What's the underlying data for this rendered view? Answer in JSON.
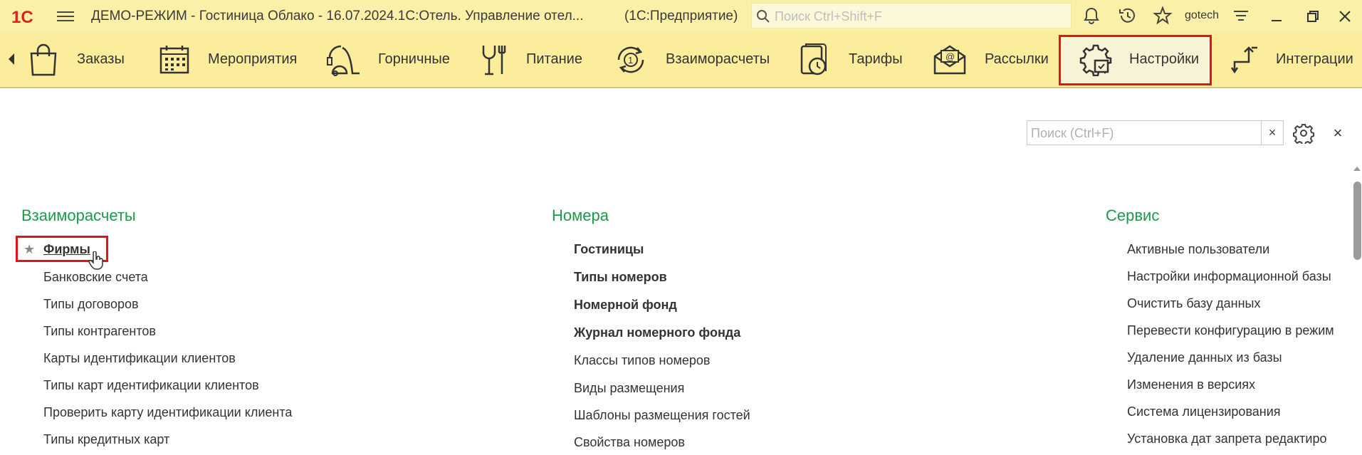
{
  "window": {
    "title": "ДЕМО-РЕЖИМ - Гостиница Облако - 16.07.2024.1С:Отель. Управление отел...",
    "suffix": "(1С:Предприятие)",
    "search_placeholder": "Поиск Ctrl+Shift+F",
    "user": "gotech",
    "logo_text": "1С"
  },
  "sections": [
    {
      "label": "Заказы",
      "icon": "shopping-bag-icon"
    },
    {
      "label": "Мероприятия",
      "icon": "calendar-icon"
    },
    {
      "label": "Горничные",
      "icon": "vacuum-cleaner-icon"
    },
    {
      "label": "Питание",
      "icon": "glass-fork-icon"
    },
    {
      "label": "Взаиморасчеты",
      "icon": "coin-cycle-icon"
    },
    {
      "label": "Тарифы",
      "icon": "tariff-book-icon"
    },
    {
      "label": "Рассылки",
      "icon": "mail-envelope-icon"
    },
    {
      "label": "Настройки",
      "icon": "settings-gear-icon",
      "active": true
    },
    {
      "label": "Интеграции",
      "icon": "integration-arrows-icon"
    }
  ],
  "content": {
    "search_placeholder": "Поиск (Ctrl+F)",
    "clear_symbol": "×",
    "close_symbol": "×",
    "groups": [
      {
        "title": "Взаиморасчеты",
        "items": [
          {
            "label": "Фирмы",
            "bold": true,
            "starred": true
          },
          {
            "label": "Банковские счета"
          },
          {
            "label": "Типы договоров"
          },
          {
            "label": "Типы контрагентов"
          },
          {
            "label": "Карты идентификации клиентов"
          },
          {
            "label": "Типы карт идентификации клиентов"
          },
          {
            "label": "Проверить карту идентификации клиента"
          },
          {
            "label": "Типы кредитных карт"
          }
        ]
      },
      {
        "title": "Номера",
        "items": [
          {
            "label": "Гостиницы",
            "bold": true
          },
          {
            "label": "Типы номеров",
            "bold": true
          },
          {
            "label": "Номерной фонд",
            "bold": true
          },
          {
            "label": "Журнал номерного фонда",
            "bold": true
          },
          {
            "label": "Классы типов номеров"
          },
          {
            "label": "Виды размещения"
          },
          {
            "label": "Шаблоны размещения гостей"
          },
          {
            "label": "Свойства номеров"
          }
        ]
      },
      {
        "title": "Сервис",
        "items": [
          {
            "label": "Активные пользователи"
          },
          {
            "label": "Настройки информационной базы"
          },
          {
            "label": "Очистить базу данных"
          },
          {
            "label": "Перевести конфигурацию в режим"
          },
          {
            "label": "Удаление данных из базы"
          },
          {
            "label": "Изменения в версиях"
          },
          {
            "label": "Система лицензирования"
          },
          {
            "label": "Установка дат запрета редактиро"
          }
        ]
      }
    ]
  },
  "colors": {
    "titlebar": "#fbf0a8",
    "section_panel": "#fbed9c",
    "group_title": "#1a9b4b",
    "highlight_frame": "#e1141c"
  }
}
